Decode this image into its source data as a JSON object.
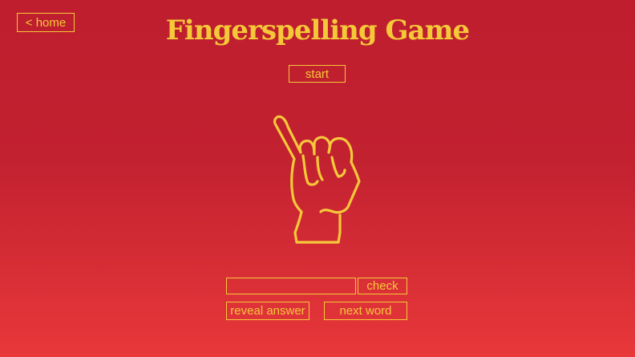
{
  "nav": {
    "home_label": "< home"
  },
  "game": {
    "title": "Fingerspelling Game",
    "start_label": "start",
    "answer_value": "",
    "check_label": "check",
    "reveal_label": "reveal answer",
    "next_label": "next word",
    "sign_icon": "hand-sign-i-icon"
  },
  "colors": {
    "accent": "#f5c83a",
    "background_top": "#be1e2d",
    "background_bottom": "#e8383a"
  }
}
